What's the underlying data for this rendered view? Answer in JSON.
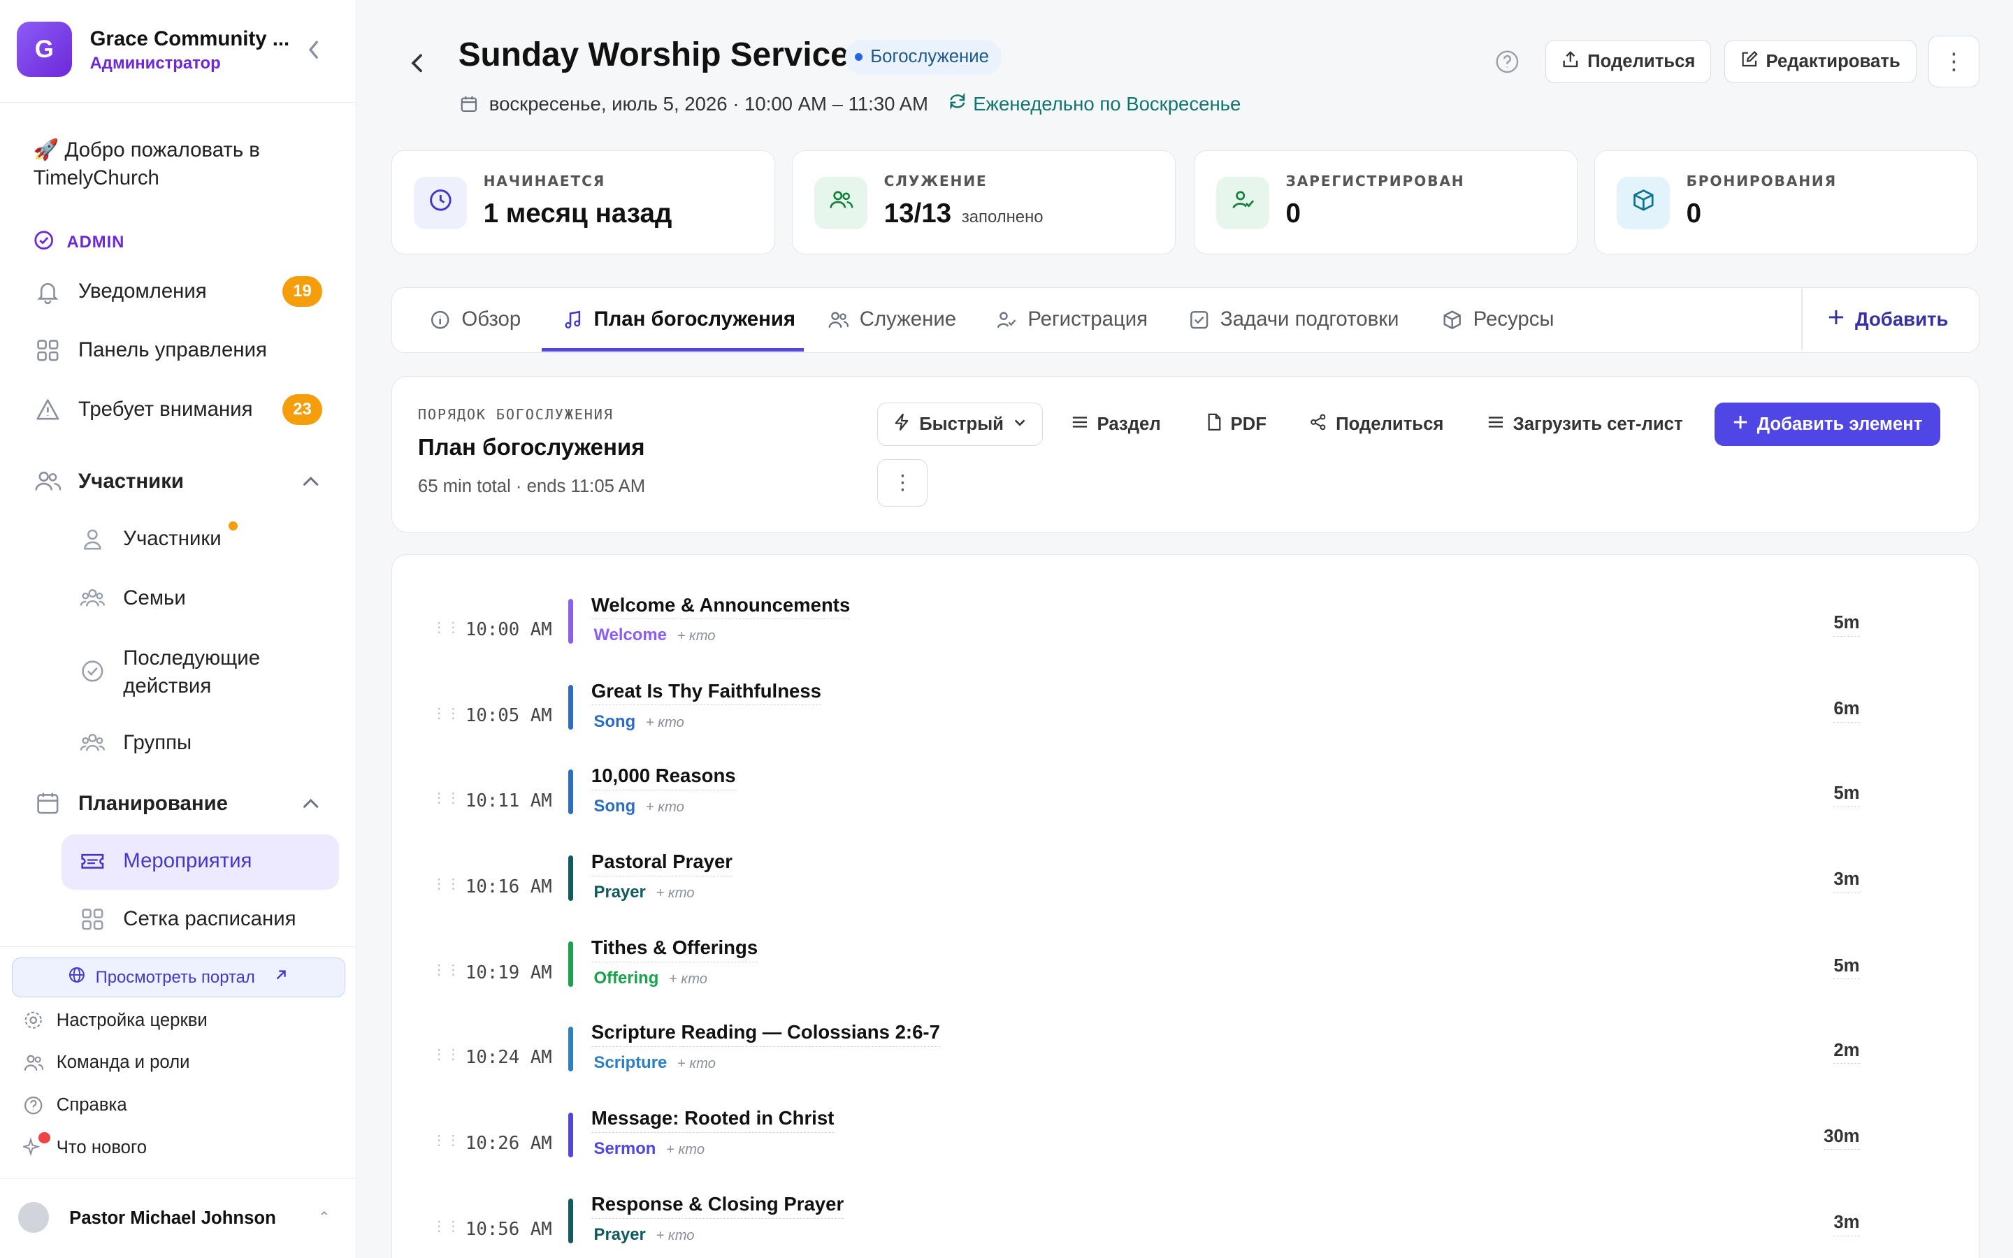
{
  "sidebar": {
    "org_initial": "G",
    "org_name": "Grace Community ...",
    "org_role": "Администратор",
    "welcome": "🚀 Добро пожаловать в TimelyChurch",
    "admin_label": "ADMIN",
    "items": [
      {
        "label": "Уведомления",
        "badge": "19",
        "icon": "bell-icon"
      },
      {
        "label": "Панель управления",
        "icon": "dashboard-grid-icon"
      },
      {
        "label": "Требует внимания",
        "badge": "23",
        "icon": "warning-triangle-icon"
      }
    ],
    "groups": [
      {
        "label": "Участники",
        "icon": "people-icon",
        "sub": [
          "Участники",
          "Семьи",
          "Последующие действия",
          "Группы"
        ]
      },
      {
        "label": "Планирование",
        "icon": "calendar-icon",
        "sub": [
          "Мероприятия",
          "Сетка расписания"
        ]
      }
    ],
    "portal_button": "Просмотреть портал",
    "footer": [
      "Настройка церкви",
      "Команда и роли",
      "Справка",
      "Что нового"
    ],
    "user_name": "Pastor Michael Johnson"
  },
  "header": {
    "title": "Sunday Worship Service",
    "type_badge": "Богослужение",
    "date": "воскресенье, июль 5, 2026 · 10:00 AM – 11:30 AM",
    "recurrence": "Еженедельно по Воскресенье",
    "share_label": "Поделиться",
    "edit_label": "Редактировать"
  },
  "stats": [
    {
      "label": "НАЧИНАЕТСЯ",
      "value": "1 месяц назад",
      "note": "",
      "icon": "clock-icon",
      "color": "#eef0fb"
    },
    {
      "label": "СЛУЖЕНИЕ",
      "value": "13/13",
      "note": "заполнено",
      "icon": "team-icon",
      "color": "#e6f6ec"
    },
    {
      "label": "ЗАРЕГИСТРИРОВАН",
      "value": "0",
      "note": "",
      "icon": "user-check-icon",
      "color": "#e6f6ec"
    },
    {
      "label": "БРОНИРОВАНИЯ",
      "value": "0",
      "note": "",
      "icon": "box-icon",
      "color": "#e3f3fb"
    }
  ],
  "tabs": [
    "Обзор",
    "План богослужения",
    "Служение",
    "Регистрация",
    "Задачи подготовки",
    "Ресурсы"
  ],
  "active_tab": "План богослужения",
  "tab_add": "Добавить",
  "order": {
    "kicker": "ПОРЯДОК БОГОСЛУЖЕНИЯ",
    "title": "План богослужения",
    "summary": "65 min total · ends 11:05 AM",
    "quick": "Быстрый",
    "section": "Раздел",
    "pdf": "PDF",
    "share": "Поделиться",
    "setlist": "Загрузить сет-лист",
    "add": "Добавить элемент"
  },
  "who_placeholder": "+ кто",
  "items": [
    {
      "time": "10:00 AM",
      "name": "Welcome & Announcements",
      "kind": "Welcome",
      "duration": "5m",
      "color": "#8b5cf6"
    },
    {
      "time": "10:05 AM",
      "name": "Great Is Thy Faithfulness",
      "kind": "Song",
      "duration": "6m",
      "color": "#2b6cc4"
    },
    {
      "time": "10:11 AM",
      "name": "10,000 Reasons",
      "kind": "Song",
      "duration": "5m",
      "color": "#2b6cc4"
    },
    {
      "time": "10:16 AM",
      "name": "Pastoral Prayer",
      "kind": "Prayer",
      "duration": "3m",
      "color": "#0f5b5f"
    },
    {
      "time": "10:19 AM",
      "name": "Tithes & Offerings",
      "kind": "Offering",
      "duration": "5m",
      "color": "#16a34a"
    },
    {
      "time": "10:24 AM",
      "name": "Scripture Reading — Colossians 2:6-7",
      "kind": "Scripture",
      "duration": "2m",
      "color": "#2b7fc4"
    },
    {
      "time": "10:26 AM",
      "name": "Message: Rooted in Christ",
      "kind": "Sermon",
      "duration": "30m",
      "color": "#4f46e5"
    },
    {
      "time": "10:56 AM",
      "name": "Response & Closing Prayer",
      "kind": "Prayer",
      "duration": "3m",
      "color": "#0f5b5f"
    }
  ]
}
